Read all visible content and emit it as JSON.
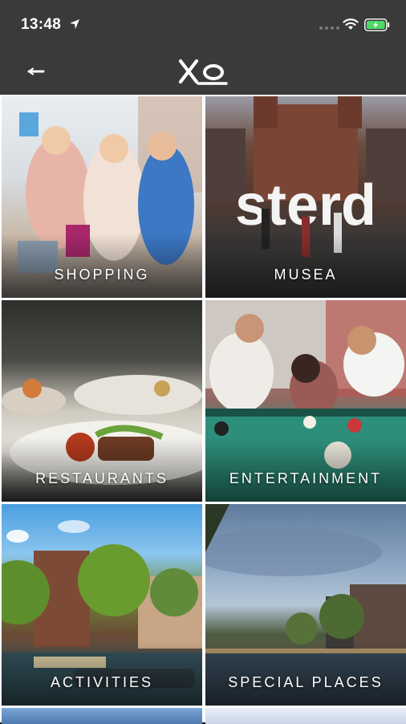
{
  "status_bar": {
    "time": "13:48",
    "location_icon": "location-arrow-icon",
    "wifi_icon": "wifi-icon",
    "battery_icon": "battery-charging-icon"
  },
  "nav": {
    "back_icon": "back-arrow-icon",
    "logo_text": "XO"
  },
  "tiles": [
    {
      "label": "SHOPPING"
    },
    {
      "label": "MUSEA"
    },
    {
      "label": "RESTAURANTS"
    },
    {
      "label": "ENTERTAINMENT"
    },
    {
      "label": "ACTIVITIES"
    },
    {
      "label": "SPECIAL PLACES"
    }
  ],
  "colors": {
    "header_bg": "#3a3a3a",
    "battery_fill": "#4cd964"
  }
}
